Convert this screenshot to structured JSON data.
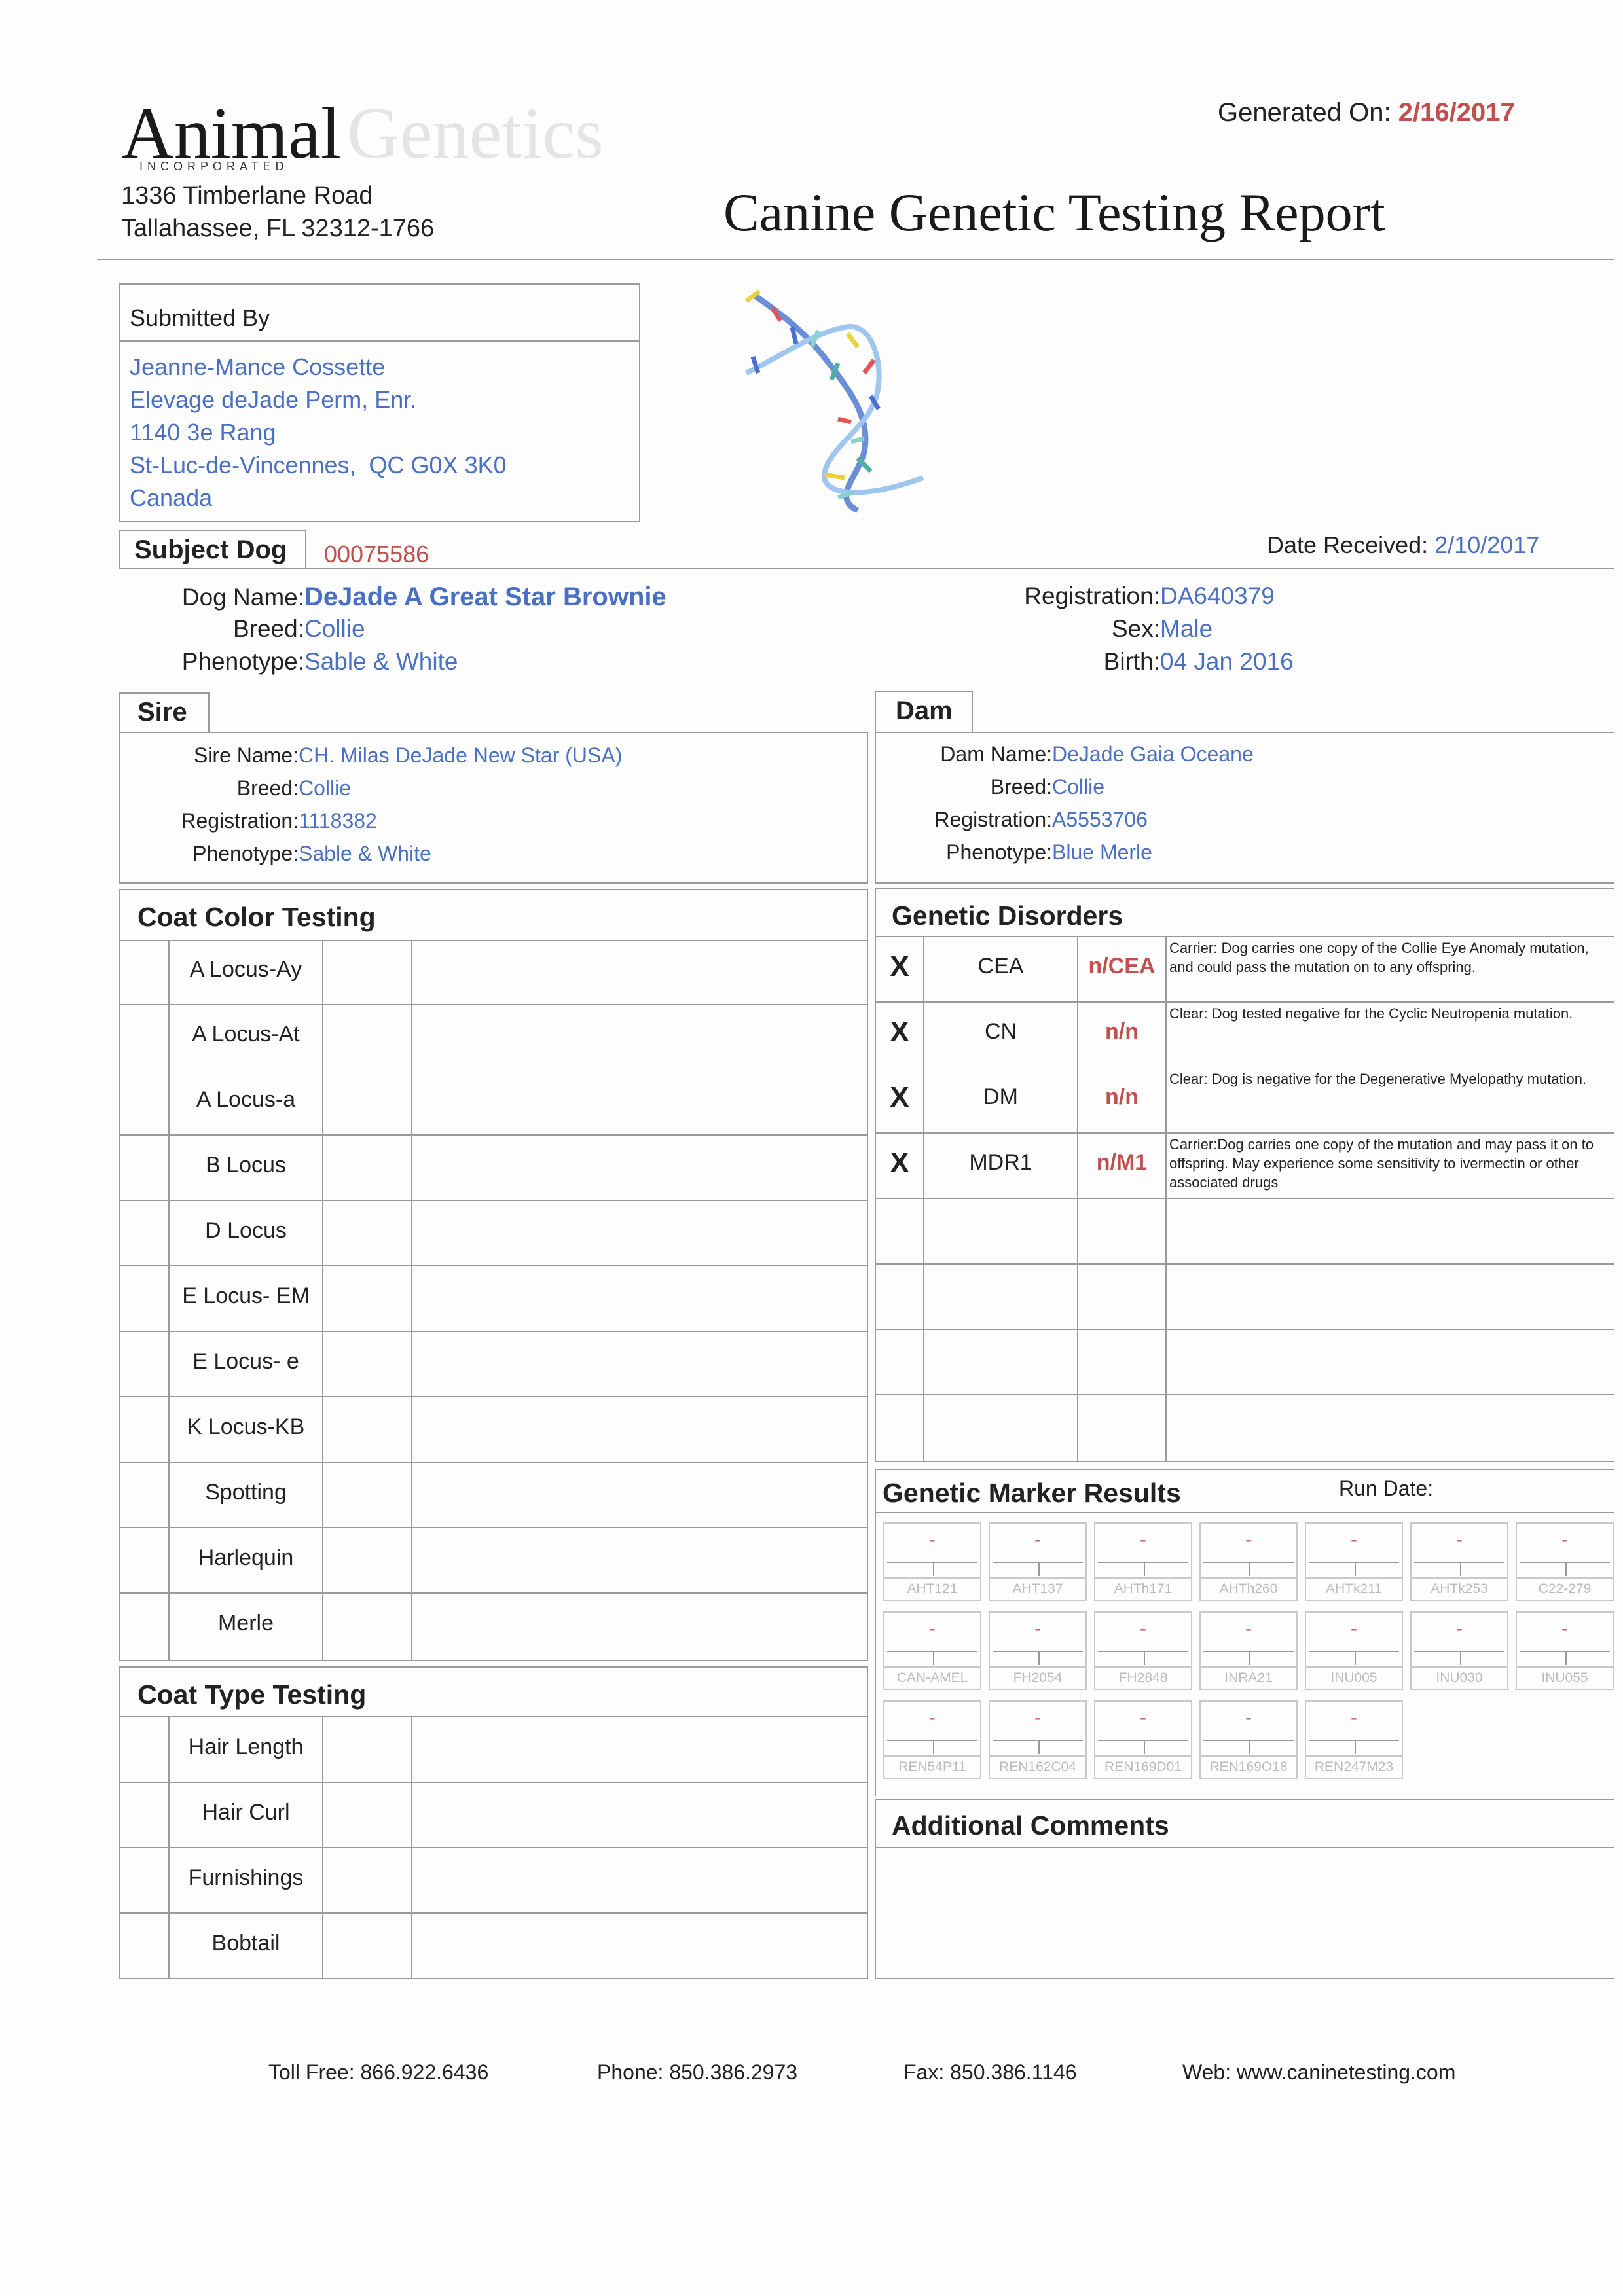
{
  "header": {
    "logo_word1": "Animal",
    "logo_word2": "Genetics",
    "logo_sub": "INCORPORATED",
    "address_line1": "1336 Timberlane Road",
    "address_line2": "Tallahassee, FL 32312-1766",
    "generated_label": "Generated On:",
    "generated_value": "2/16/2017",
    "report_title": "Canine Genetic Testing Report"
  },
  "submitted": {
    "title": "Submitted By",
    "lines": [
      "Jeanne-Mance Cossette",
      "Elevage deJade Perm, Enr.",
      "1140 3e Rang",
      "St-Luc-de-Vincennes,  QC G0X 3K0",
      "Canada"
    ]
  },
  "subject": {
    "title": "Subject Dog",
    "id": "00075586",
    "date_received_label": "Date Received:",
    "date_received": "2/10/2017",
    "dog_name_label": "Dog Name:",
    "dog_name": "DeJade A Great Star Brownie",
    "breed_label": "Breed:",
    "breed": "Collie",
    "phenotype_label": "Phenotype:",
    "phenotype": "Sable & White",
    "registration_label": "Registration:",
    "registration": "DA640379",
    "sex_label": "Sex:",
    "sex": "Male",
    "birth_label": "Birth:",
    "birth": "04 Jan 2016"
  },
  "sire": {
    "title": "Sire",
    "name_label": "Sire Name:",
    "name": "CH. Milas DeJade New Star (USA)",
    "breed_label": "Breed:",
    "breed": "Collie",
    "registration_label": "Registration:",
    "registration": "1118382",
    "phenotype_label": "Phenotype:",
    "phenotype": "Sable & White"
  },
  "dam": {
    "title": "Dam",
    "name_label": "Dam Name:",
    "name": "DeJade Gaia Oceane",
    "breed_label": "Breed:",
    "breed": "Collie",
    "registration_label": "Registration:",
    "registration": "A5553706",
    "phenotype_label": "Phenotype:",
    "phenotype": "Blue Merle"
  },
  "coat_color": {
    "title": "Coat Color Testing",
    "rows": [
      "A Locus-Ay",
      "A Locus-At",
      "A Locus-a",
      "B Locus",
      "D Locus",
      "E Locus- EM",
      "E Locus- e",
      "K Locus-KB",
      "Spotting",
      "Harlequin",
      "Merle"
    ]
  },
  "coat_type": {
    "title": "Coat Type Testing",
    "rows": [
      "Hair Length",
      "Hair Curl",
      "Furnishings",
      "Bobtail"
    ]
  },
  "disorders": {
    "title": "Genetic Disorders",
    "rows": [
      {
        "mark": "X",
        "name": "CEA",
        "result": "n/CEA",
        "note": "Carrier: Dog carries one copy of the Collie Eye Anomaly mutation, and could pass the mutation on to any offspring."
      },
      {
        "mark": "X",
        "name": "CN",
        "result": "n/n",
        "note": "Clear: Dog tested negative for the Cyclic Neutropenia mutation."
      },
      {
        "mark": "X",
        "name": "DM",
        "result": "n/n",
        "note": "Clear: Dog is negative for the Degenerative Myelopathy mutation."
      },
      {
        "mark": "X",
        "name": "MDR1",
        "result": "n/M1",
        "note": "Carrier:Dog carries one copy of  the mutation and may pass it on to offspring. May experience some sensitivity to ivermectin or other associated drugs"
      }
    ]
  },
  "markers": {
    "title": "Genetic Marker Results",
    "run_date_label": "Run Date:",
    "value": "-",
    "names": [
      "AHT121",
      "AHT137",
      "AHTh171",
      "AHTh260",
      "AHTk211",
      "AHTk253",
      "C22-279",
      "CAN-AMEL",
      "FH2054",
      "FH2848",
      "INRA21",
      "INU005",
      "INU030",
      "INU055",
      "REN54P11",
      "REN162C04",
      "REN169D01",
      "REN169O18",
      "REN247M23"
    ]
  },
  "comments": {
    "title": "Additional Comments"
  },
  "footer": {
    "toll_free": "Toll Free: 866.922.6436",
    "phone": "Phone: 850.386.2973",
    "fax": "Fax: 850.386.1146",
    "web": "Web: www.caninetesting.com"
  },
  "colors": {
    "accent_blue": "#4a70c2",
    "accent_red": "#c0504d",
    "rule_gray": "#9a9a9a"
  }
}
